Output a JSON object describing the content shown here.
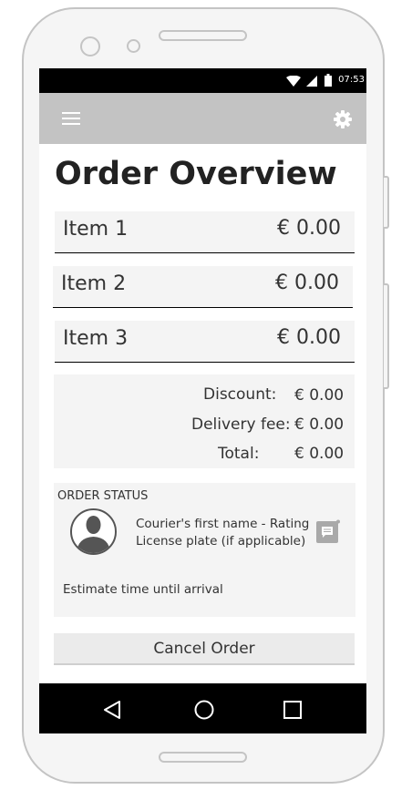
{
  "status_bar": {
    "time": "07:53"
  },
  "app_bar": {
    "menu_icon": "hamburger-menu-icon",
    "settings_icon": "gear-icon"
  },
  "page": {
    "title": "Order Overview"
  },
  "items": [
    {
      "name": "Item 1",
      "price": "€ 0.00"
    },
    {
      "name": "Item 2",
      "price": "€ 0.00"
    },
    {
      "name": "Item 3",
      "price": "€ 0.00"
    }
  ],
  "summary": {
    "discount_label": "Discount:",
    "discount_value": "€ 0.00",
    "delivery_label": "Delivery fee:",
    "delivery_value": "€ 0.00",
    "total_label": "Total:",
    "total_value": "€ 0.00"
  },
  "order_status": {
    "heading": "ORDER STATUS",
    "courier_line": "Courier's first name - Rating",
    "plate_line": "License plate (if applicable)",
    "eta": "Estimate time until arrival",
    "chat_icon": "chat-icon"
  },
  "actions": {
    "cancel_label": "Cancel Order"
  },
  "nav_bar": {
    "back_icon": "back-triangle-icon",
    "home_icon": "home-circle-icon",
    "recents_icon": "recents-square-icon"
  },
  "colors": {
    "app_bar": "#c3c3c3",
    "surface": "#f4f4f4",
    "button": "#ebebeb",
    "bars": "#000000"
  }
}
